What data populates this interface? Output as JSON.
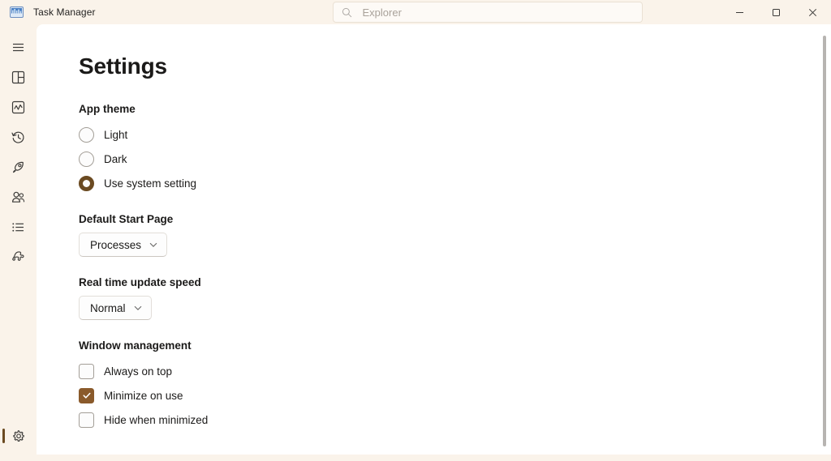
{
  "window": {
    "app_title": "Task Manager",
    "app_icon": "task-manager-chart-icon",
    "controls": {
      "minimize": "minimize-icon",
      "maximize": "maximize-icon",
      "close": "close-icon"
    }
  },
  "search": {
    "icon": "search-icon",
    "placeholder": "Explorer",
    "value": ""
  },
  "sidebar": {
    "items": [
      {
        "name": "hamburger-menu",
        "icon": "hamburger-icon",
        "selected": false
      },
      {
        "name": "processes",
        "icon": "processes-grid-icon",
        "selected": false
      },
      {
        "name": "performance",
        "icon": "performance-chart-icon",
        "selected": false
      },
      {
        "name": "app-history",
        "icon": "history-clock-icon",
        "selected": false
      },
      {
        "name": "startup-apps",
        "icon": "rocket-icon",
        "selected": false
      },
      {
        "name": "users",
        "icon": "users-icon",
        "selected": false
      },
      {
        "name": "details",
        "icon": "details-list-icon",
        "selected": false
      },
      {
        "name": "services",
        "icon": "services-gear-icon",
        "selected": false
      }
    ],
    "bottom": {
      "name": "settings",
      "icon": "settings-gear-icon",
      "selected": true
    }
  },
  "main": {
    "page_title": "Settings",
    "sections": {
      "app_theme": {
        "title": "App theme",
        "options": [
          {
            "label": "Light",
            "checked": false
          },
          {
            "label": "Dark",
            "checked": false
          },
          {
            "label": "Use system setting",
            "checked": true
          }
        ]
      },
      "default_start_page": {
        "title": "Default Start Page",
        "selected": "Processes",
        "chevron": "chevron-down-icon"
      },
      "update_speed": {
        "title": "Real time update speed",
        "selected": "Normal",
        "chevron": "chevron-down-icon"
      },
      "window_management": {
        "title": "Window management",
        "options": [
          {
            "label": "Always on top",
            "checked": false
          },
          {
            "label": "Minimize on use",
            "checked": true
          },
          {
            "label": "Hide when minimized",
            "checked": false
          }
        ]
      }
    }
  },
  "colors": {
    "accent": "#8a5a2b",
    "accent_dark": "#6b4a21",
    "titlebar_bg": "#faf3ea",
    "content_bg": "#ffffff",
    "text": "#1b1a19"
  }
}
